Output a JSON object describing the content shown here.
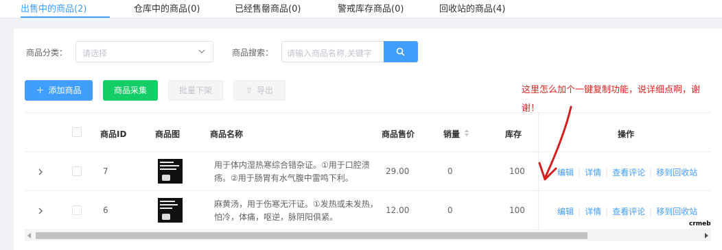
{
  "tabs": [
    {
      "label": "出售中的商品(2)",
      "active": true
    },
    {
      "label": "仓库中的商品(0)",
      "active": false
    },
    {
      "label": "已经售罄商品(0)",
      "active": false
    },
    {
      "label": "警戒库存商品(0)",
      "active": false
    },
    {
      "label": "回收站的商品(4)",
      "active": false
    }
  ],
  "filters": {
    "category_label": "商品分类：",
    "category_placeholder": "请选择",
    "search_label": "商品搜索：",
    "search_placeholder": "请输入商品名称,关键字"
  },
  "toolbar": {
    "add_label": "添加商品",
    "collect_label": "商品采集",
    "batch_off_label": "批量下架",
    "export_label": "导出"
  },
  "table": {
    "headers": {
      "id": "商品ID",
      "image": "商品图",
      "name": "商品名称",
      "price": "商品售价",
      "sales": "销量",
      "stock": "库存",
      "ops": "操作"
    },
    "rows": [
      {
        "id": "7",
        "name": "用于体内湿热寒综合错杂证。①用于口腔溃疡。②用于肠胃有水气腹中雷鸣下利。",
        "price": "29.00",
        "sales": "0",
        "stock": "100"
      },
      {
        "id": "6",
        "name": "麻黄汤，用于伤寒无汗证。①发热或未发热，怕冷，体痛，呕逆，脉阴阳俱紧。",
        "price": "12.00",
        "sales": "0",
        "stock": "100"
      }
    ],
    "row_actions": {
      "edit": "编辑",
      "detail": "详情",
      "reviews": "查看评论",
      "recycle": "移到回收站"
    }
  },
  "annotation": {
    "text": "这里怎么加个一键复制功能，说详细点啊，谢谢！",
    "color": "#e02020"
  },
  "watermark": "crmeb",
  "colors": {
    "primary": "#409eff",
    "success": "#13ce66",
    "note": "#e02020"
  }
}
